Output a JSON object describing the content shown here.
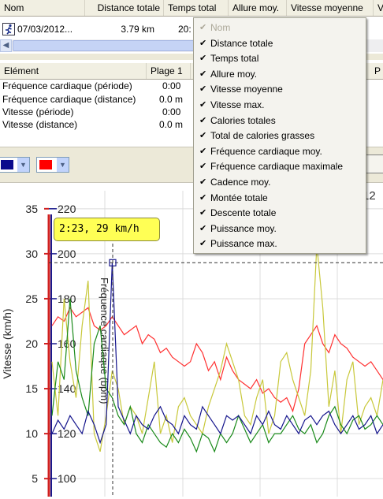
{
  "activity_table": {
    "columns": [
      "Nom",
      "Distance totale",
      "Temps total",
      "Allure moy.",
      "Vitesse moyenne",
      "V"
    ],
    "row": {
      "name": "07/03/2012...",
      "distance": "3.79 km",
      "time": "20:"
    }
  },
  "details_table": {
    "columns": [
      "Elément",
      "Plage 1",
      "P"
    ],
    "rows": [
      {
        "element": "Fréquence cardiaque (période)",
        "value": "0:00"
      },
      {
        "element": "Fréquence cardiaque (distance)",
        "value": "0.0 m"
      },
      {
        "element": "Vitesse (période)",
        "value": "0:00"
      },
      {
        "element": "Vitesse (distance)",
        "value": "0.0 m"
      }
    ]
  },
  "toolbar": {
    "color1": "#0a0a8c",
    "color2": "#ff0000",
    "button_partial": "re",
    "number_partial": "12"
  },
  "context_menu": {
    "items": [
      {
        "label": "Nom",
        "checked": true,
        "enabled": false
      },
      {
        "label": "Distance totale",
        "checked": true,
        "enabled": true
      },
      {
        "label": "Temps total",
        "checked": true,
        "enabled": true
      },
      {
        "label": "Allure moy.",
        "checked": true,
        "enabled": true
      },
      {
        "label": "Vitesse moyenne",
        "checked": true,
        "enabled": true
      },
      {
        "label": "Vitesse max.",
        "checked": true,
        "enabled": true
      },
      {
        "label": "Calories totales",
        "checked": true,
        "enabled": true
      },
      {
        "label": "Total de calories grasses",
        "checked": true,
        "enabled": true
      },
      {
        "label": "Fréquence cardiaque moy.",
        "checked": true,
        "enabled": true
      },
      {
        "label": "Fréquence cardiaque maximale",
        "checked": true,
        "enabled": true
      },
      {
        "label": "Cadence moy.",
        "checked": true,
        "enabled": true
      },
      {
        "label": "Montée totale",
        "checked": true,
        "enabled": true
      },
      {
        "label": "Descente totale",
        "checked": true,
        "enabled": true
      },
      {
        "label": "Puissance moy.",
        "checked": true,
        "enabled": true
      },
      {
        "label": "Puissance max.",
        "checked": true,
        "enabled": true
      }
    ]
  },
  "chart_data": {
    "type": "line",
    "tooltip": "2:23, 29 km/h",
    "y_left": {
      "label": "Vitesse (km/h)",
      "ticks": [
        35,
        30,
        25,
        20,
        15,
        10,
        5
      ],
      "range": [
        3,
        37
      ]
    },
    "y_right": {
      "label": "Fréquence cardiaque (bpm)",
      "ticks": [
        220,
        200,
        180,
        160,
        140,
        120,
        100
      ],
      "range": [
        92,
        228
      ]
    },
    "cursor": {
      "time": "2:23",
      "value": 29
    },
    "series": [
      {
        "color": "#ff3030",
        "values": [
          22,
          23,
          22.5,
          24,
          23,
          23.5,
          24,
          22,
          21.5,
          22,
          23,
          22,
          21,
          21.5,
          22,
          20,
          21,
          20.5,
          19,
          19.5,
          18.5,
          18,
          17.5,
          18,
          20,
          19,
          17,
          18,
          16,
          18.5,
          17,
          16,
          15.5,
          15,
          16,
          14.5,
          15,
          14,
          13.5,
          14,
          12.5,
          15,
          20,
          21,
          22,
          20,
          19,
          21,
          20,
          19.5,
          18.5,
          18,
          17.5,
          18,
          17,
          16
        ]
      },
      {
        "color": "#c8c83a",
        "values": [
          18,
          12,
          25,
          18,
          14,
          22,
          27,
          10,
          8,
          12,
          17,
          15,
          11,
          13,
          12,
          10,
          14,
          18,
          10,
          12,
          9,
          13,
          14,
          12,
          11,
          10,
          13,
          15,
          17,
          20,
          18,
          16,
          12,
          11,
          14,
          16,
          10,
          12,
          18,
          19,
          16,
          14,
          12,
          17,
          31,
          24,
          13,
          17,
          10,
          16,
          18,
          11,
          13,
          14,
          12,
          16
        ]
      },
      {
        "color": "#1a8a1a",
        "values": [
          12,
          18,
          16,
          25,
          17,
          14,
          12,
          20,
          22,
          15,
          14,
          12,
          11,
          13,
          10,
          9,
          11,
          10,
          9,
          8.5,
          10,
          9,
          10.5,
          9.5,
          8,
          10,
          9.5,
          8,
          10,
          9,
          10,
          12,
          10.5,
          9,
          10,
          11,
          9,
          10,
          10,
          11,
          12,
          10.5,
          10,
          11,
          9,
          10,
          12,
          13,
          11,
          10,
          11.5,
          12,
          10.5,
          11,
          12,
          11
        ]
      },
      {
        "color": "#14148c",
        "values": [
          10,
          11.5,
          10.5,
          12,
          11,
          10,
          12.5,
          11,
          9,
          11,
          29,
          13,
          11.5,
          10,
          12,
          11,
          10.5,
          12,
          13,
          11.5,
          11,
          10,
          12,
          11,
          10.5,
          13,
          12,
          11,
          10,
          12,
          11.5,
          12,
          11,
          10,
          12,
          11,
          12.5,
          11,
          10.5,
          12,
          11,
          10,
          11.5,
          12,
          11,
          12,
          12.5,
          11,
          10,
          11,
          12,
          10.5,
          11,
          12,
          10,
          11
        ]
      }
    ]
  }
}
